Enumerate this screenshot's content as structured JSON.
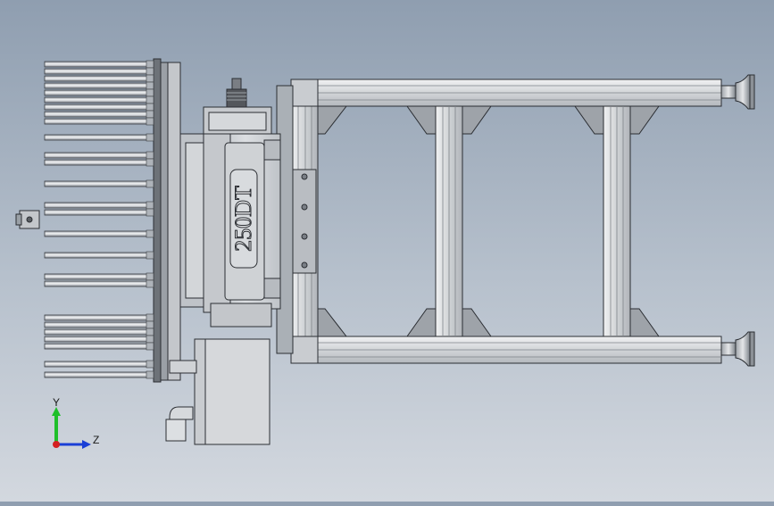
{
  "model_label": "250DT",
  "triad": {
    "y_label": "Y",
    "z_label": "Z",
    "y_color": "#1fbf2a",
    "z_color": "#1a3fd6",
    "origin_color": "#d42020"
  },
  "colors": {
    "background_top": "#8f9eb0",
    "background_bottom": "#d3d8df",
    "steel_light": "#e6e8ea",
    "steel_mid": "#c4c7ca",
    "steel_dark": "#8c9096",
    "outline": "#2b2e33"
  }
}
